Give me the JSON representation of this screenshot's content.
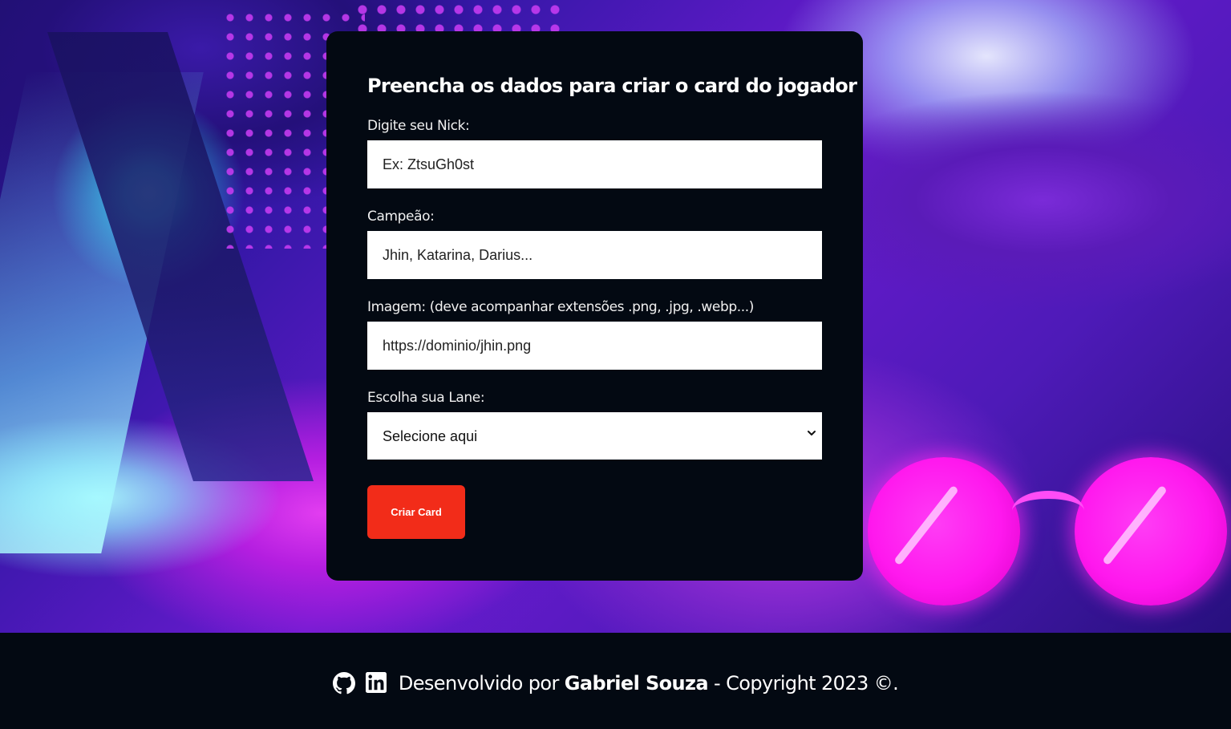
{
  "form": {
    "title": "Preencha os dados para criar o card do jogador",
    "nick": {
      "label": "Digite seu Nick:",
      "placeholder": "Ex: ZtsuGh0st"
    },
    "champion": {
      "label": "Campeão:",
      "placeholder": "Jhin, Katarina, Darius..."
    },
    "image": {
      "label": "Imagem: (deve acompanhar extensões .png, .jpg, .webp...)",
      "placeholder": "https://dominio/jhin.png"
    },
    "lane": {
      "label": "Escolha sua Lane:",
      "selected": "Selecione aqui"
    },
    "submit_label": "Criar Card",
    "submit_color": "#f22c19"
  },
  "footer": {
    "icons": [
      "github-icon",
      "linkedin-icon"
    ],
    "prefix": "Desenvolvido por ",
    "author": "Gabriel Souza",
    "suffix": " - Copyright 2023 ©."
  }
}
